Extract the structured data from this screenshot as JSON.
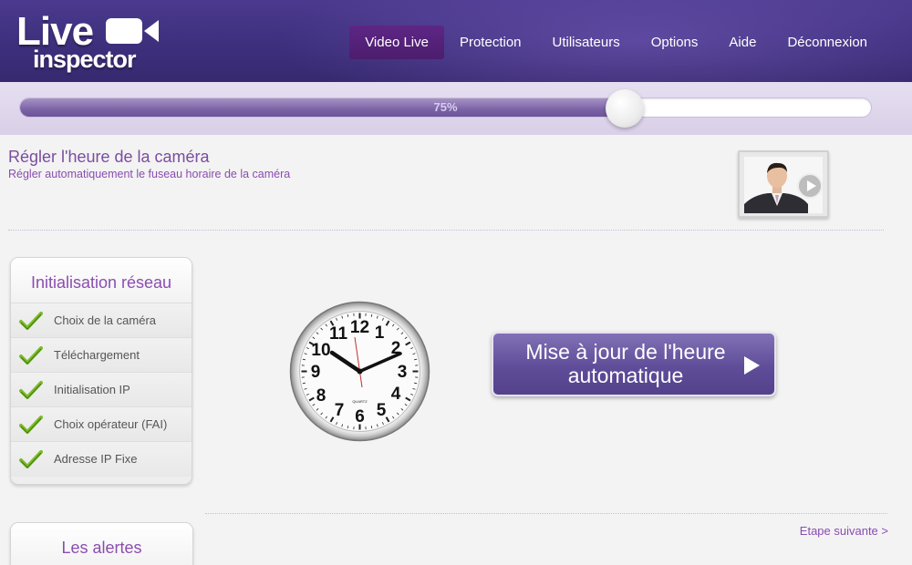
{
  "header": {
    "logo_line1": "Live",
    "logo_line2": "inspector",
    "nav": [
      {
        "label": "Video Live",
        "active": true
      },
      {
        "label": "Protection"
      },
      {
        "label": "Utilisateurs"
      },
      {
        "label": "Options"
      },
      {
        "label": "Aide"
      },
      {
        "label": "Déconnexion"
      }
    ]
  },
  "progress": {
    "label": "75%",
    "fraction": 0.71
  },
  "page": {
    "title": "Régler l'heure de la caméra",
    "subtitle": "Régler automatiquement le fuseau horaire de la caméra"
  },
  "sidebar": {
    "network_panel": {
      "title": "Initialisation réseau",
      "steps": [
        "Choix de la caméra",
        "Téléchargement",
        "Initialisation IP",
        "Choix opérateur (FAI)",
        "Adresse IP Fixe"
      ]
    },
    "alerts_panel": {
      "title": "Les alertes"
    }
  },
  "clock": {
    "brand": "QUARTZ",
    "numbers": [
      "12",
      "1",
      "2",
      "3",
      "4",
      "5",
      "6",
      "7",
      "8",
      "9",
      "10",
      "11"
    ]
  },
  "main": {
    "update_button_line1": "Mise à jour de l'heure",
    "update_button_line2": "automatique",
    "next_link": "Etape suivante >"
  },
  "colors": {
    "accent": "#8a4db0",
    "header": "#3e2f7d",
    "button": "#5f4d99",
    "check": "#7dbb2a"
  }
}
